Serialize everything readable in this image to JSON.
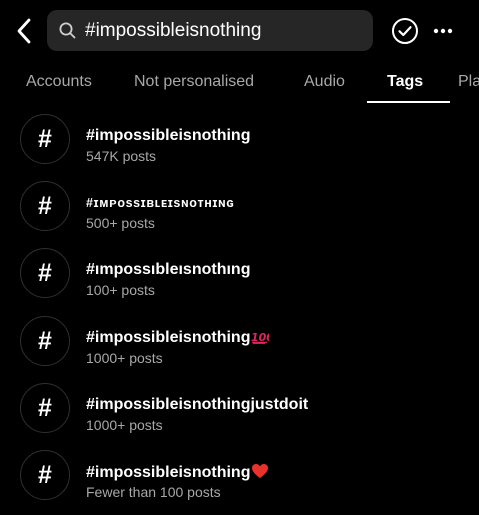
{
  "header": {
    "back_icon": "chevron-left-icon",
    "search": {
      "icon": "search-icon",
      "value": "#impossibleisnothing",
      "placeholder": "Search"
    },
    "check_icon": "check-circle-icon",
    "more_icon": "more-horizontal-icon"
  },
  "tabs": [
    {
      "label": "Accounts",
      "active": false
    },
    {
      "label": "Not personalised",
      "active": false
    },
    {
      "label": "Audio",
      "active": false
    },
    {
      "label": "Tags",
      "active": true
    },
    {
      "label": "Pla",
      "active": false
    }
  ],
  "results": [
    {
      "symbol": "#",
      "name": "#impossibleisnothing",
      "count": "547K posts"
    },
    {
      "symbol": "#",
      "name": "#ɪᴍᴘᴏssɪʙʟᴇɪsɴᴏᴛʜɪɴɢ",
      "count": "500+ posts"
    },
    {
      "symbol": "#",
      "name": "#ımpossıbleısnothıng",
      "count": "100+ posts"
    },
    {
      "symbol": "#",
      "name": "#impossibleisnothing",
      "emoji": "💯",
      "count": "1000+ posts"
    },
    {
      "symbol": "#",
      "name": "#impossibleisnothingjustdoit",
      "count": "1000+ posts"
    },
    {
      "symbol": "#",
      "name": "#impossibleisnothing",
      "emoji": "❤️",
      "count": "Fewer than 100 posts"
    }
  ],
  "colors": {
    "background": "#000000",
    "search_bg": "#262626",
    "primary_text": "#ffffff",
    "secondary_text": "#a8a8a8",
    "hundred_emoji": "#e0245e",
    "heart_emoji": "#e8332c"
  }
}
